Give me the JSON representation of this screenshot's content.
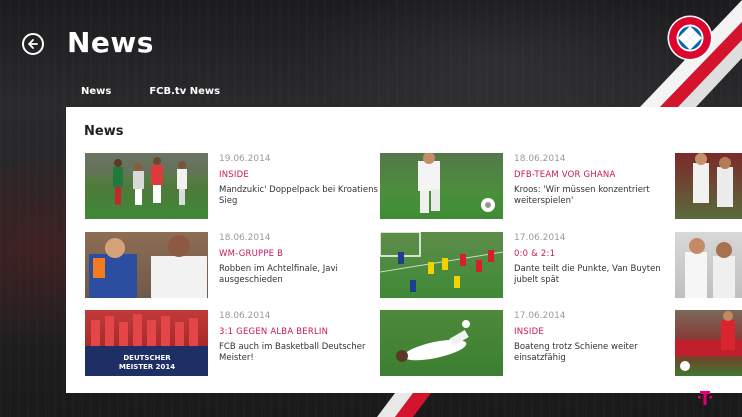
{
  "header": {
    "title": "News",
    "tabs": [
      {
        "label": "News"
      },
      {
        "label": "FCB.tv News"
      }
    ]
  },
  "logo": {
    "text_top": "FC BAYERN",
    "text_bottom": "MÜNCHEN",
    "colors": {
      "red": "#dc052d",
      "blue": "#0066b2"
    }
  },
  "section": {
    "title": "News"
  },
  "articles": [
    {
      "date": "19.06.2014",
      "category": "INSIDE",
      "headline": "Mandzukic' Doppelpack bei Kroatiens Sieg"
    },
    {
      "date": "18.06.2014",
      "category": "DFB-TEAM VOR GHANA",
      "headline": "Kroos: 'Wir müssen konzentriert weiterspielen'"
    },
    {
      "date": "18.06.2014",
      "category": "WM-GRUPPE B",
      "headline": "Robben im Achtelfinale, Javi ausgeschieden"
    },
    {
      "date": "17.06.2014",
      "category": "0:0 & 2:1",
      "headline": "Dante teilt die Punkte, Van Buyten jubelt spät"
    },
    {
      "date": "18.06.2014",
      "category": "3:1 GEGEN ALBA BERLIN",
      "headline": "FCB auch im Basketball Deutscher Meister!"
    },
    {
      "date": "17.06.2014",
      "category": "INSIDE",
      "headline": "Boateng trotz Schiene weiter einsatzfähig"
    }
  ],
  "banner_text": {
    "line1": "DEUTSCHER",
    "line2": "MEISTER 2014"
  },
  "brand": {
    "accent": "#c8175e",
    "stripe_red": "#d4142c",
    "telekom_magenta": "#e20074"
  }
}
